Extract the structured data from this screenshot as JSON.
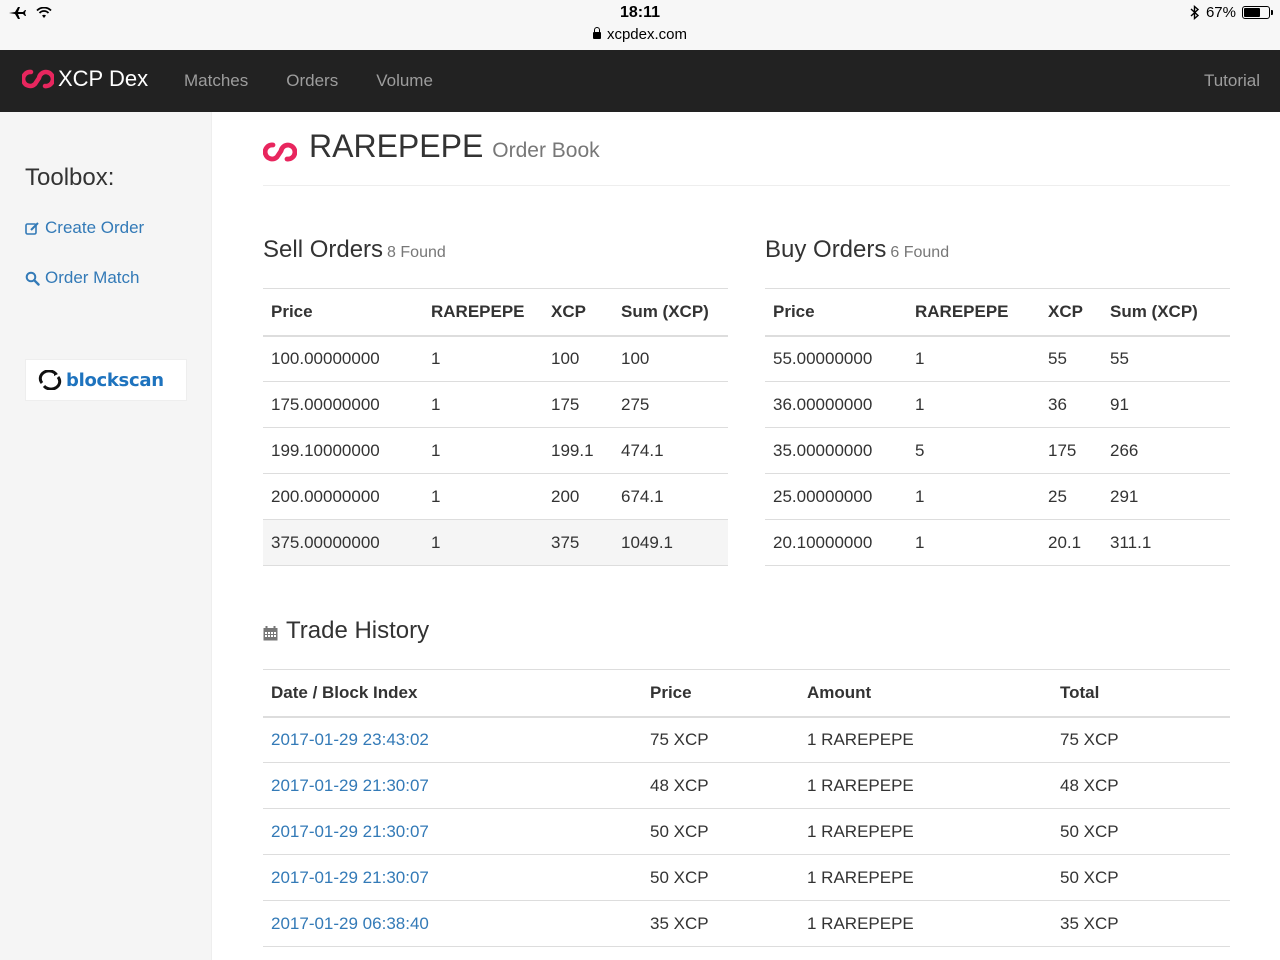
{
  "statusbar": {
    "time": "18:11",
    "url": "xcpdex.com",
    "battery": "67%"
  },
  "nav": {
    "brand": "XCP Dex",
    "links": [
      "Matches",
      "Orders",
      "Volume"
    ],
    "right": "Tutorial"
  },
  "sidebar": {
    "title": "Toolbox:",
    "create_order": "Create Order",
    "order_match": "Order Match",
    "blockscan": "blockscan"
  },
  "header": {
    "asset": "RAREPEPE",
    "subtitle": "Order Book"
  },
  "sell": {
    "title": "Sell Orders",
    "found": "8 Found",
    "columns": [
      "Price",
      "RAREPEPE",
      "XCP",
      "Sum (XCP)"
    ],
    "rows": [
      [
        "100.00000000",
        "1",
        "100",
        "100"
      ],
      [
        "175.00000000",
        "1",
        "175",
        "275"
      ],
      [
        "199.10000000",
        "1",
        "199.1",
        "474.1"
      ],
      [
        "200.00000000",
        "1",
        "200",
        "674.1"
      ],
      [
        "375.00000000",
        "1",
        "375",
        "1049.1"
      ]
    ]
  },
  "buy": {
    "title": "Buy Orders",
    "found": "6 Found",
    "columns": [
      "Price",
      "RAREPEPE",
      "XCP",
      "Sum (XCP)"
    ],
    "rows": [
      [
        "55.00000000",
        "1",
        "55",
        "55"
      ],
      [
        "36.00000000",
        "1",
        "36",
        "91"
      ],
      [
        "35.00000000",
        "5",
        "175",
        "266"
      ],
      [
        "25.00000000",
        "1",
        "25",
        "291"
      ],
      [
        "20.10000000",
        "1",
        "20.1",
        "311.1"
      ]
    ]
  },
  "history": {
    "title": "Trade History",
    "columns": [
      "Date / Block Index",
      "Price",
      "Amount",
      "Total"
    ],
    "rows": [
      [
        "2017-01-29 23:43:02",
        "75 XCP",
        "1 RAREPEPE",
        "75 XCP"
      ],
      [
        "2017-01-29 21:30:07",
        "48 XCP",
        "1 RAREPEPE",
        "48 XCP"
      ],
      [
        "2017-01-29 21:30:07",
        "50 XCP",
        "1 RAREPEPE",
        "50 XCP"
      ],
      [
        "2017-01-29 21:30:07",
        "50 XCP",
        "1 RAREPEPE",
        "50 XCP"
      ],
      [
        "2017-01-29 06:38:40",
        "35 XCP",
        "1 RAREPEPE",
        "35 XCP"
      ]
    ]
  },
  "colors": {
    "brand": "#e8265e",
    "link": "#337ab7",
    "navbar": "#222222"
  }
}
